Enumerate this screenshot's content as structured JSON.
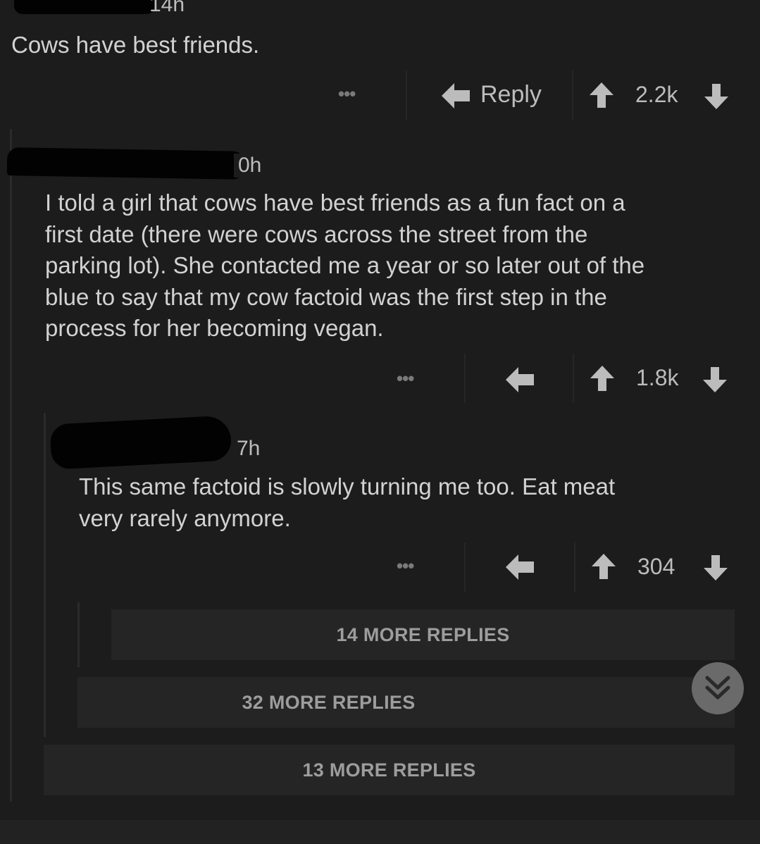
{
  "comments": [
    {
      "time": "14h",
      "text": "Cows have best friends.",
      "menu": "•••",
      "reply_label": "Reply",
      "score": "2.2k"
    },
    {
      "time": "0h",
      "text_lines": [
        "I told a girl that cows have best friends as a fun fact on a",
        "first date (there were cows across the street from the",
        "parking lot).  She contacted me a year or so later out of the",
        "blue to say that my cow factoid was the first step in the",
        "process for her becoming vegan."
      ],
      "menu": "•••",
      "score": "1.8k"
    },
    {
      "time": "7h",
      "text_lines": [
        "This same factoid is slowly turning me too. Eat meat",
        "very rarely anymore."
      ],
      "menu": "•••",
      "score": "304"
    }
  ],
  "more_replies": [
    {
      "label": "14 MORE REPLIES"
    },
    {
      "label": "32 MORE REPLIES"
    },
    {
      "label": "13 MORE REPLIES"
    }
  ],
  "icons": {
    "reply": "reply-arrow-icon",
    "upvote": "upvote-arrow-icon",
    "downvote": "downvote-arrow-icon",
    "scroll": "double-chevron-down-icon"
  },
  "colors": {
    "background": "#1c1c1c",
    "text": "#d2d2d2",
    "muted": "#9d9d9d",
    "more_bg": "#252525",
    "fab": "#6a6a6a"
  }
}
